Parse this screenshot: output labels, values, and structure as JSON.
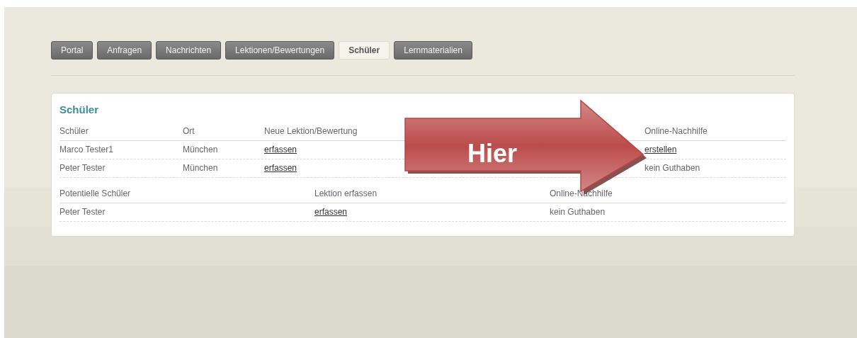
{
  "tabs": [
    {
      "label": "Portal",
      "selected": false
    },
    {
      "label": "Anfragen",
      "selected": false
    },
    {
      "label": "Nachrichten",
      "selected": false
    },
    {
      "label": "Lektionen/Bewertungen",
      "selected": false
    },
    {
      "label": "Schüler",
      "selected": true
    },
    {
      "label": "Lernmaterialien",
      "selected": false
    }
  ],
  "panel": {
    "title": "Schüler",
    "students": {
      "columns": [
        "Schüler",
        "Ort",
        "Neue Lektion/Bewertung",
        "Online-Nachhilfe"
      ],
      "rows": [
        {
          "cells": [
            {
              "text": "Marco Tester1",
              "kind": "text"
            },
            {
              "text": "München",
              "kind": "text"
            },
            {
              "text": "erfassen",
              "kind": "link"
            },
            {
              "text": "erstellen",
              "kind": "link"
            }
          ]
        },
        {
          "cells": [
            {
              "text": "Peter Tester",
              "kind": "text"
            },
            {
              "text": "München",
              "kind": "text"
            },
            {
              "text": "erfassen",
              "kind": "link"
            },
            {
              "text": "kein Guthaben",
              "kind": "text"
            }
          ]
        }
      ]
    },
    "potential_students": {
      "columns": [
        "Potentielle Schüler",
        "Lektion erfassen",
        "Online-Nachhilfe"
      ],
      "rows": [
        {
          "cells": [
            {
              "text": "Peter Tester",
              "kind": "text"
            },
            {
              "text": "erfassen",
              "kind": "link"
            },
            {
              "text": "kein Guthaben",
              "kind": "text"
            }
          ]
        }
      ]
    }
  },
  "callout": {
    "label": "Hier"
  }
}
